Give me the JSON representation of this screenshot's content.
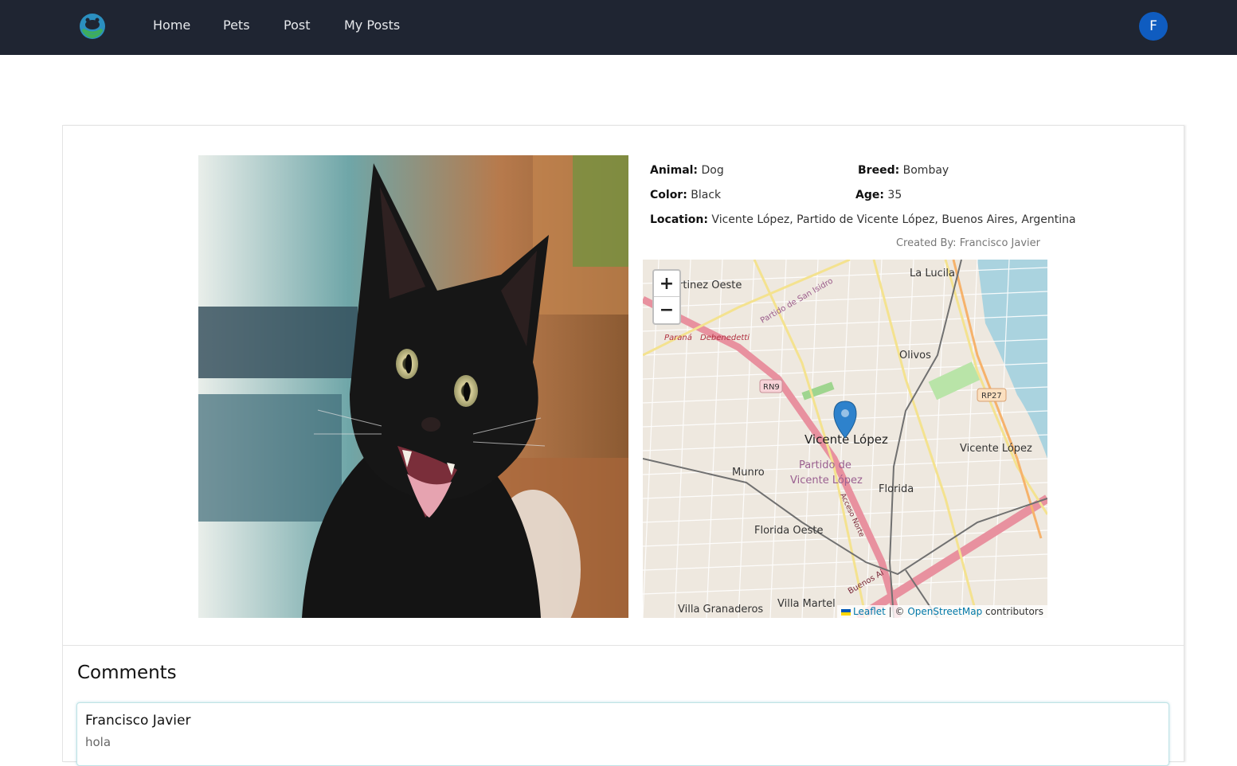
{
  "nav": {
    "logo_icon": "paw-globe-logo",
    "links": [
      "Home",
      "Pets",
      "Post",
      "My Posts"
    ],
    "avatar_initial": "F"
  },
  "pet": {
    "photo": "black cat photo",
    "animal_label": "Animal:",
    "animal": "Dog",
    "breed_label": "Breed:",
    "breed": "Bombay",
    "color_label": "Color:",
    "color": "Black",
    "age_label": "Age:",
    "age": "35",
    "location_label": "Location:",
    "location": "Vicente López, Partido de Vicente López, Buenos Aires, Argentina",
    "created_by": "Created By: Francisco Javier"
  },
  "map": {
    "zoom_in": "+",
    "zoom_out": "−",
    "marker_icon": "map-pin-icon",
    "labels": [
      "rtinez Oeste",
      "La Lucila",
      "Partido de San Isidro",
      "Paraná",
      "Debenedetti",
      "Olivos",
      "RN9",
      "RP27",
      "Vicente López",
      "Vicente López",
      "Partido de",
      "Vicente López",
      "Munro",
      "Florida",
      "Acceso Norte",
      "Florida Oeste",
      "Villa Granaderos",
      "Villa Martel",
      "Buenos Ai"
    ],
    "attribution_leaflet": "Leaflet",
    "attribution_sep": " | © ",
    "attribution_osm": "OpenStreetMap",
    "attribution_suffix": " contributors"
  },
  "comments": {
    "title": "Comments",
    "items": [
      {
        "author": "Francisco Javier",
        "text": "hola"
      }
    ]
  },
  "colors": {
    "navbar": "#1f2532",
    "avatar": "#0f5cc0",
    "link": "#0078a8"
  }
}
